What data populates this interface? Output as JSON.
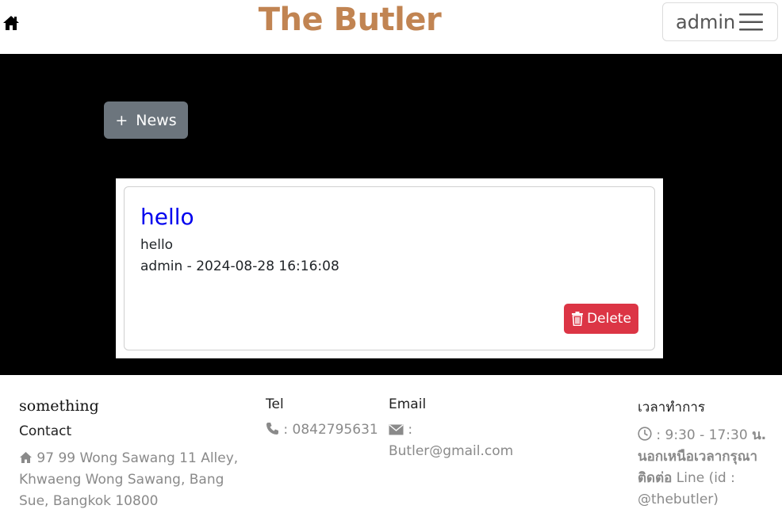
{
  "header": {
    "brand": "The Butler",
    "user_name": "admin"
  },
  "actions": {
    "add_news_label": "News"
  },
  "news": [
    {
      "title": "hello",
      "body": "hello",
      "meta": "admin - 2024-08-28 16:16:08",
      "delete_label": "Delete"
    }
  ],
  "footer": {
    "brand": "something",
    "contact_label": "Contact",
    "address": "97 99 Wong Sawang 11 Alley, Khwaeng Wong Sawang, Bang Sue, Bangkok 10800",
    "tel_label": "Tel",
    "tel_value": ": 0842795631",
    "email_label": "Email",
    "email_value": ": Butler@gmail.com",
    "hours_label": "เวลาทำการ",
    "hours_time": ": 9:30 - 17:30",
    "hours_unit": "น.",
    "hours_after": "นอกเหนือเวลากรุณาติดต่อ",
    "hours_line": "Line (id : @thebutler)"
  },
  "colors": {
    "brand": "#c18452",
    "secondary_button": "#6c757d",
    "danger_button": "#dc3545",
    "link_title": "#0000ee",
    "muted_text": "#8a8a8a"
  },
  "icons": [
    "home-icon",
    "hamburger-menu-icon",
    "plus-icon",
    "trash-icon",
    "house-small-icon",
    "phone-icon",
    "envelope-icon",
    "clock-icon"
  ]
}
